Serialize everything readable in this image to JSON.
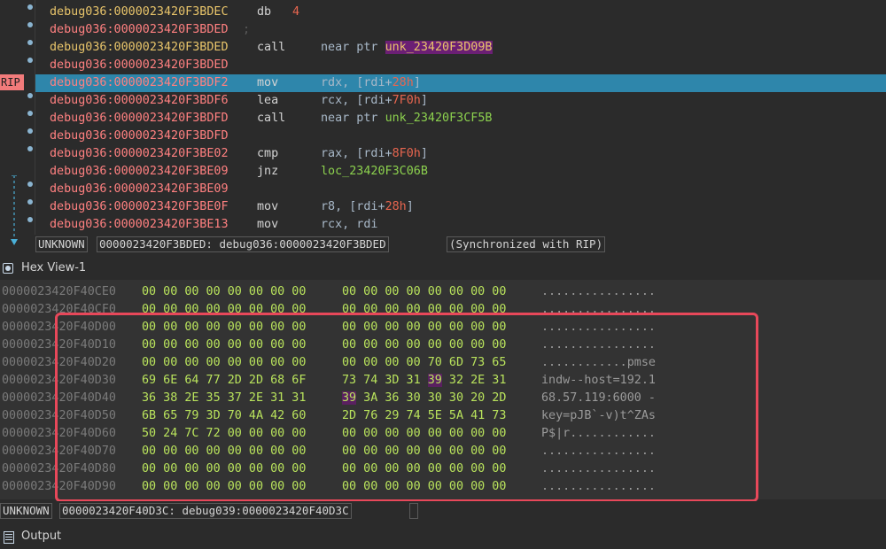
{
  "disasm": {
    "rip_label": "RIP",
    "lines": [
      {
        "addr": "debug036:0000023420F3BDEC",
        "mnem": "db",
        "op": "4",
        "style": "db"
      },
      {
        "addr": "debug036:0000023420F3BDED",
        "mnem": "",
        "op": ";",
        "style": "comment"
      },
      {
        "addr": "debug036:0000023420F3BDED",
        "mnem": "call",
        "op_pre": "near ptr ",
        "op_sym": "unk_23420F3D09B",
        "style": "call-hl"
      },
      {
        "addr": "debug036:0000023420F3BDED",
        "mnem": "",
        "op": "",
        "style": "blank"
      },
      {
        "addr": "debug036:0000023420F3BDF2",
        "mnem": "mov",
        "op_reg": "rdx, [rdi+",
        "op_num": "28h",
        "op_end": "]",
        "style": "current"
      },
      {
        "addr": "debug036:0000023420F3BDF6",
        "mnem": "lea",
        "op_reg": "rcx, [rdi+",
        "op_num": "7F0h",
        "op_end": "]",
        "style": "memop"
      },
      {
        "addr": "debug036:0000023420F3BDFD",
        "mnem": "call",
        "op_pre": "near ptr ",
        "op_sym": "unk_23420F3CF5B",
        "style": "call"
      },
      {
        "addr": "debug036:0000023420F3BDFD",
        "mnem": "",
        "op": "",
        "style": "blank"
      },
      {
        "addr": "debug036:0000023420F3BE02",
        "mnem": "cmp",
        "op_reg": "rax, [rdi+",
        "op_num": "8F0h",
        "op_end": "]",
        "style": "memop"
      },
      {
        "addr": "debug036:0000023420F3BE09",
        "mnem": "jnz",
        "op_sym": "loc_23420F3C06B",
        "style": "jump"
      },
      {
        "addr": "debug036:0000023420F3BE09",
        "mnem": "",
        "op": "",
        "style": "blank"
      },
      {
        "addr": "debug036:0000023420F3BE0F",
        "mnem": "mov",
        "op_reg": "r8, [rdi+",
        "op_num": "28h",
        "op_end": "]",
        "style": "memop"
      },
      {
        "addr": "debug036:0000023420F3BE13",
        "mnem": "mov",
        "op_reg": "rcx, rdi",
        "style": "regop"
      }
    ],
    "status": {
      "segment": "UNKNOWN",
      "location": "0000023420F3BDED: debug036:0000023420F3BDED",
      "sync": "(Synchronized with RIP)"
    }
  },
  "hex": {
    "title": "Hex View-1",
    "rows": [
      {
        "addr": "0000023420F40CE0",
        "b1": "00 00 00 00 00 00 00 00",
        "b2": "00 00 00 00 00 00 00 00",
        "ascii": "................"
      },
      {
        "addr": "0000023420F40CF0",
        "b1": "00 00 00 00 00 00 00 00",
        "b2": "00 00 00 00 00 00 00 00",
        "ascii": "................"
      },
      {
        "addr": "0000023420F40D00",
        "b1": "00 00 00 00 00 00 00 00",
        "b2": "00 00 00 00 00 00 00 00",
        "ascii": "................"
      },
      {
        "addr": "0000023420F40D10",
        "b1": "00 00 00 00 00 00 00 00",
        "b2": "00 00 00 00 00 00 00 00",
        "ascii": "................"
      },
      {
        "addr": "0000023420F40D20",
        "b1": "00 00 00 00 00 00 00 00",
        "b2": "00 00 00 00 70 6D 73 65",
        "ascii": "............pmse"
      },
      {
        "addr": "0000023420F40D30",
        "b1": "69 6E 64 77 2D 2D 68 6F",
        "b2a": "73 74 3D 31 ",
        "b2h": "39",
        "b2b": " 32 2E 31",
        "ascii": "indw--host=192.1"
      },
      {
        "addr": "0000023420F40D40",
        "b1": "36 38 2E 35 37 2E 31 31",
        "b2a": "",
        "b2h": "39",
        "b2b": " 3A 36 30 30 30 20 2D",
        "ascii": "68.57.119:6000 -"
      },
      {
        "addr": "0000023420F40D50",
        "b1": "6B 65 79 3D 70 4A 42 60",
        "b2": "2D 76 29 74 5E 5A 41 73",
        "ascii": "key=pJB`-v)t^ZAs"
      },
      {
        "addr": "0000023420F40D60",
        "b1": "50 24 7C 72 00 00 00 00",
        "b2": "00 00 00 00 00 00 00 00",
        "ascii": "P$|r............"
      },
      {
        "addr": "0000023420F40D70",
        "b1": "00 00 00 00 00 00 00 00",
        "b2": "00 00 00 00 00 00 00 00",
        "ascii": "................"
      },
      {
        "addr": "0000023420F40D80",
        "b1": "00 00 00 00 00 00 00 00",
        "b2": "00 00 00 00 00 00 00 00",
        "ascii": "................"
      },
      {
        "addr": "0000023420F40D90",
        "b1": "00 00 00 00 00 00 00 00",
        "b2": "00 00 00 00 00 00 00 00",
        "ascii": "................"
      }
    ],
    "status": {
      "segment": "UNKNOWN",
      "location": "0000023420F40D3C: debug039:0000023420F40D3C"
    }
  },
  "output": {
    "title": "Output"
  },
  "colors": {
    "rip_label": "#f27b7b",
    "current_line": "#2e86ab",
    "highlight_box": "#e8485a",
    "hex_bytes": "#b9e35c"
  }
}
